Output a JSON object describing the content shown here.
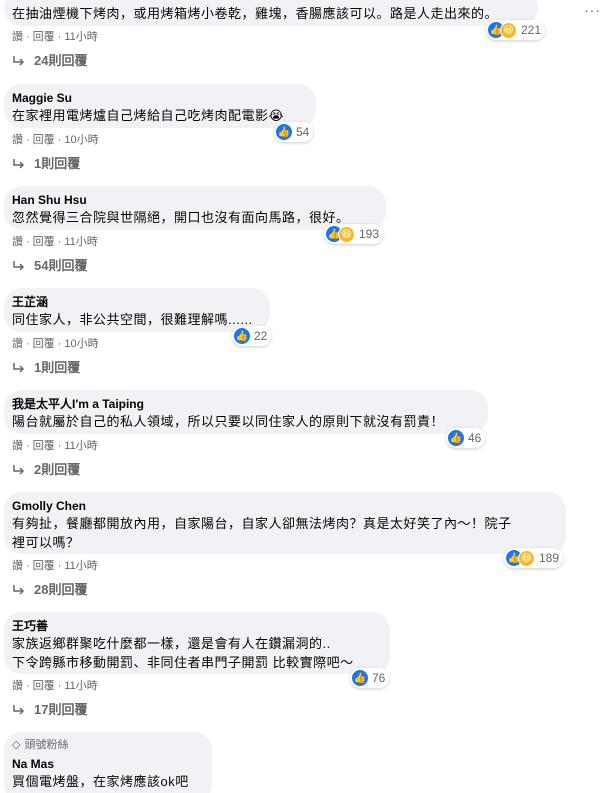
{
  "comments": [
    {
      "author": "",
      "lines": [
        "在抽油煙機下烤肉，或用烤箱烤小卷乾，雞塊，香腸應該可以。路是人走出來的。"
      ],
      "reactions": {
        "types": [
          "like-icon",
          "haha-icon"
        ],
        "count": "221"
      },
      "actions": {
        "like": "讚",
        "reply": "回覆",
        "time": "11小時"
      },
      "replies": "24則回覆"
    },
    {
      "author": "Maggie Su",
      "lines": [
        "在家裡用電烤爐自己烤給自己吃烤肉配電影😭"
      ],
      "reactions": {
        "types": [
          "like-icon"
        ],
        "count": "54"
      },
      "actions": {
        "like": "讚",
        "reply": "回覆",
        "time": "10小時"
      },
      "replies": "1則回覆"
    },
    {
      "author": "Han Shu Hsu",
      "lines": [
        "忽然覺得三合院與世隔絕，開口也沒有面向馬路，很好。"
      ],
      "reactions": {
        "types": [
          "like-icon",
          "haha-icon"
        ],
        "count": "193"
      },
      "actions": {
        "like": "讚",
        "reply": "回覆",
        "time": "11小時"
      },
      "replies": "54則回覆"
    },
    {
      "author": "王芷涵",
      "lines": [
        "同住家人，非公共空間，很難理解嗎......"
      ],
      "reactions": {
        "types": [
          "like-icon"
        ],
        "count": "22"
      },
      "actions": {
        "like": "讚",
        "reply": "回覆",
        "time": "10小時"
      },
      "replies": "1則回覆"
    },
    {
      "author": "我是太平人I'm a Taiping",
      "lines": [
        "陽台就屬於自己的私人領域，所以只要以同住家人的原則下就沒有罰責！"
      ],
      "reactions": {
        "types": [
          "like-icon"
        ],
        "count": "46"
      },
      "actions": {
        "like": "讚",
        "reply": "回覆",
        "time": "11小時"
      },
      "replies": "2則回覆"
    },
    {
      "author": "Gmolly Chen",
      "lines": [
        "有夠扯，餐廳都開放內用，自家陽台，自家人卻無法烤肉？真是太好笑了內～！院子",
        "裡可以嗎？"
      ],
      "reactions": {
        "types": [
          "like-icon",
          "haha-icon"
        ],
        "count": "189"
      },
      "actions": {
        "like": "讚",
        "reply": "回覆",
        "time": "11小時"
      },
      "replies": "28則回覆"
    },
    {
      "author": "王巧善",
      "lines": [
        "家族返鄉群聚吃什麼都一樣，還是會有人在鑽漏洞的..",
        "下令跨縣市移動開罰、非同住者串門子開罰 比較實際吧～"
      ],
      "reactions": {
        "types": [
          "like-icon"
        ],
        "count": "76"
      },
      "actions": {
        "like": "讚",
        "reply": "回覆",
        "time": "11小時"
      },
      "replies": "17則回覆"
    },
    {
      "badge": "頭號粉絲",
      "author": "Na Mas",
      "lines": [
        "買個電烤盤，在家烤應該ok吧"
      ]
    }
  ],
  "icons": {
    "like": "like-icon",
    "haha": "haha-icon",
    "reply_arrow": "reply-arrow-icon",
    "more": "more-options-icon",
    "badge": "diamond-icon"
  },
  "colors": {
    "bubble": "#f0f2f5",
    "like_blue": "#1877f2",
    "haha_yellow": "#f7b928",
    "meta_gray": "#65676b"
  }
}
